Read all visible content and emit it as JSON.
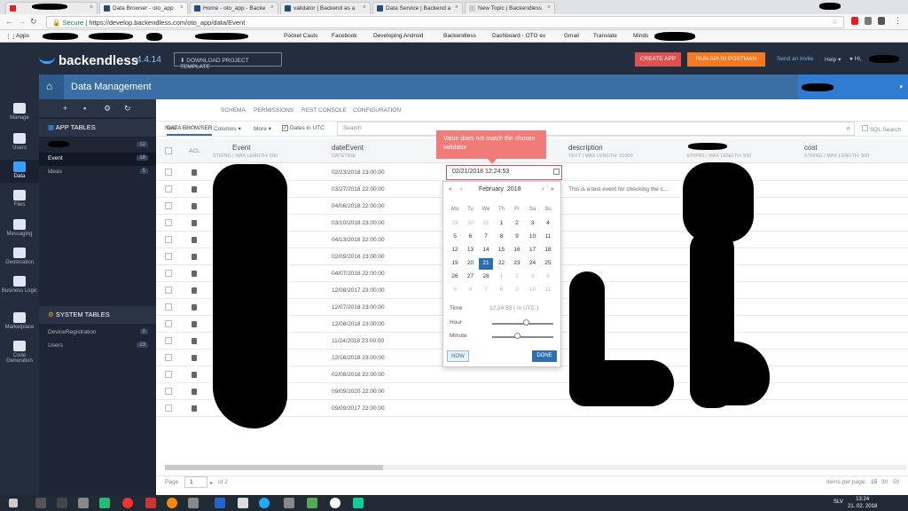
{
  "browser": {
    "tabs": [
      {
        "label": ""
      },
      {
        "label": "Data Browser - oto_app"
      },
      {
        "label": "Home - oto_app - Backe"
      },
      {
        "label": "validator | Backend as a"
      },
      {
        "label": "Data Service | Backend a"
      },
      {
        "label": "New Topic | Backendless"
      }
    ],
    "secure_label": "Secure",
    "url": "https://develop.backendless.com/oto_app/data/Event",
    "bookmarks": [
      "Apps",
      "Pocket Casts",
      "Facebook",
      "Developing Android",
      "Backendless",
      "Dashboard - OTO ev",
      "Gmail",
      "Translate",
      "Minds"
    ]
  },
  "header": {
    "logo": "backendless",
    "version": "4.4.14",
    "download_button": "DOWNLOAD PROJECT TEMPLATE",
    "create_app_button": "CREATE APP",
    "postman_button": "RUN API IN POSTMAN",
    "invite_link": "Send an Invite",
    "help_menu": "Help",
    "greeting": "Hi,"
  },
  "leftnav": [
    "Manage",
    "Users",
    "Data",
    "Files",
    "Messaging",
    "Geolocation",
    "Business Logic",
    "Marketplace",
    "Code Generation"
  ],
  "page_title": "Data Management",
  "app_tables": {
    "heading": "APP TABLES",
    "items": [
      {
        "name": "",
        "count": "12"
      },
      {
        "name": "Event",
        "count": "18"
      },
      {
        "name": "Ideas",
        "count": "5"
      }
    ]
  },
  "system_tables": {
    "heading": "SYSTEM TABLES",
    "items": [
      {
        "name": "DeviceRegistration",
        "count": "0"
      },
      {
        "name": "Users",
        "count": "23"
      }
    ]
  },
  "subtabs": [
    "DATA BROWSER",
    "SCHEMA",
    "PERMISSIONS",
    "REST CONSOLE",
    "CONFIGURATION"
  ],
  "actions": {
    "new": "New",
    "delete": "Delete",
    "columns": "Columns",
    "more": "More",
    "dates_utc": "Dates in UTC"
  },
  "search": {
    "placeholder": "Search",
    "sql_label": "SQL Search"
  },
  "columns": [
    {
      "name": "ACL",
      "sub": ""
    },
    {
      "name": "Event",
      "sub": "STRING | MAX LENGTH: 500"
    },
    {
      "name": "dateEvent",
      "sub": "DATETIME"
    },
    {
      "name": "description",
      "sub": "TEXT | MAX LENGTH: 21000"
    },
    {
      "name": "",
      "sub": "STRING | MAX LENGTH: 500"
    },
    {
      "name": "cost",
      "sub": "STRING | MAX LENGTH: 500"
    }
  ],
  "rows": [
    {
      "date": "02/23/2018 23:00:00",
      "desc": ""
    },
    {
      "date": "03/27/2018 22:00:00",
      "desc": "This is a test event for checking the c..."
    },
    {
      "date": "04/06/2018 22:00:00",
      "desc": ""
    },
    {
      "date": "03/10/2018 23:00:00",
      "desc": ""
    },
    {
      "date": "04/13/2018 22:00:00",
      "desc": ""
    },
    {
      "date": "02/09/2018 23:00:00",
      "desc": ""
    },
    {
      "date": "04/07/2018 22:00:00",
      "desc": ""
    },
    {
      "date": "12/08/2017 23:00:00",
      "desc": ""
    },
    {
      "date": "12/07/2018 23:00:00",
      "desc": ""
    },
    {
      "date": "12/08/2018 23:00:00",
      "desc": ""
    },
    {
      "date": "11/24/2018 23:00:00",
      "desc": ""
    },
    {
      "date": "12/16/2018 23:00:00",
      "desc": ""
    },
    {
      "date": "02/08/2018 22:00:00",
      "desc": ""
    },
    {
      "date": "09/09/2020 22:00:00",
      "desc": ""
    },
    {
      "date": "09/09/2017 22:00:00",
      "desc": ""
    }
  ],
  "error_tooltip": "Value does not match the chosen validator",
  "date_input_value": "02/21/2018 12:24:53",
  "datepicker": {
    "prev_year": "«",
    "prev_month": "‹",
    "next_month": "›",
    "next_year": "»",
    "month": "February",
    "year": "2018",
    "dow": [
      "Mo",
      "Tu",
      "We",
      "Th",
      "Fr",
      "Sa",
      "Su"
    ],
    "weeks": [
      [
        "29",
        "30",
        "31",
        "1",
        "2",
        "3",
        "4"
      ],
      [
        "5",
        "6",
        "7",
        "8",
        "9",
        "10",
        "11"
      ],
      [
        "12",
        "13",
        "14",
        "15",
        "16",
        "17",
        "18"
      ],
      [
        "19",
        "20",
        "21",
        "22",
        "23",
        "24",
        "25"
      ],
      [
        "26",
        "27",
        "28",
        "1",
        "2",
        "3",
        "4"
      ],
      [
        "5",
        "6",
        "7",
        "8",
        "9",
        "10",
        "11"
      ]
    ],
    "selected_day": "21",
    "time_label": "Time",
    "time_value": "12:24:53",
    "time_suffix": "( in UTC )",
    "hour_label": "Hour",
    "minute_label": "Minute",
    "hour_level": 0.55,
    "minute_level": 0.4,
    "now_button": "NOW",
    "done_button": "DONE"
  },
  "pager": {
    "page_label": "Page",
    "page_value": "1",
    "of_label": "of 2",
    "items_label": "Items per page:",
    "options": [
      "15",
      "30",
      "50"
    ]
  },
  "taskbar": {
    "lang": "SLV",
    "time": "13:24",
    "date": "21. 02. 2018"
  }
}
